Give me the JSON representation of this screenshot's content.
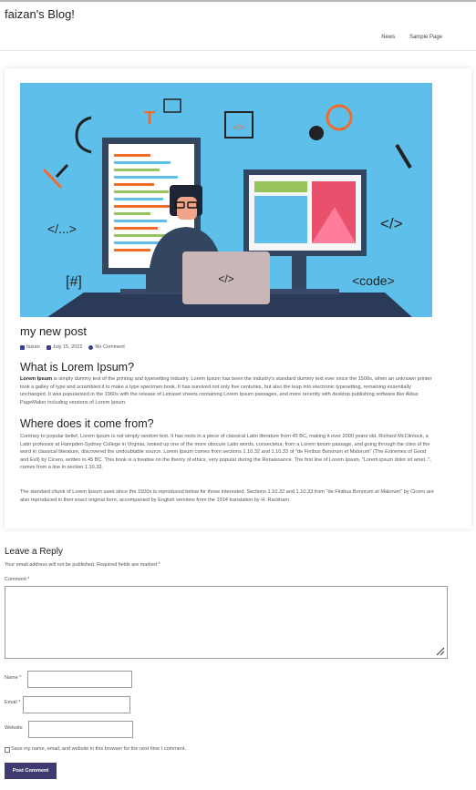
{
  "site": {
    "title": "faizan's Blog!"
  },
  "nav": {
    "items": [
      "News",
      "Sample Page"
    ]
  },
  "post": {
    "title": "my new post",
    "author": "faizan",
    "date": "July 15, 2022",
    "comments": "No Comment",
    "section1_heading": "What is Lorem Ipsum?",
    "section1_lead": "Lorem Ipsum",
    "section1_body": " is simply dummy text of the printing and typesetting industry. Lorem Ipsum has been the industry's standard dummy text ever since the 1500s, when an unknown printer took a galley of type and scrambled it to make a type specimen book. It has survived not only five centuries, but also the leap into electronic typesetting, remaining essentially unchanged. It was popularised in the 1960s with the release of Letraset sheets containing Lorem Ipsum passages, and more recently with desktop publishing software like Aldus PageMaker including versions of Lorem Ipsum.",
    "section2_heading": "Where does it come from?",
    "section2_p1": "Contrary to popular belief, Lorem Ipsum is not simply random text. It has roots in a piece of classical Latin literature from 45 BC, making it over 2000 years old. Richard McClintock, a Latin professor at Hampden-Sydney College in Virginia, looked up one of the more obscure Latin words, consectetur, from a Lorem Ipsum passage, and going through the cites of the word in classical literature, discovered the undoubtable source. Lorem Ipsum comes from sections 1.10.32 and 1.10.33 of \"de Finibus Bonorum et Malorum\" (The Extremes of Good and Evil) by Cicero, written in 45 BC. This book is a treatise on the theory of ethics, very popular during the Renaissance. The first line of Lorem Ipsum, \"Lorem ipsum dolor sit amet..\", comes from a line in section 1.10.32.",
    "section2_p2": "The standard chunk of Lorem Ipsum used since the 1500s is reproduced below for those interested. Sections 1.10.32 and 1.10.33 from \"de Finibus Bonorum et Malorum\" by Cicero are also reproduced in their exact original form, accompanied by English versions from the 1914 translation by H. Rackham."
  },
  "hero": {
    "code_tag": "</>",
    "tag_left": "</...>",
    "tag_right": "</>",
    "tag_hash": "[#]",
    "tag_code": "<code>",
    "letter_t": "T"
  },
  "reply": {
    "title": "Leave a Reply",
    "notes": "Your email address will not be published. Required fields are marked *",
    "comment_label": "Comment *",
    "name_label": "Name *",
    "email_label": "Email *",
    "website_label": "Website",
    "save_label": "Save my name, email, and website in this browser for the next time I comment.",
    "submit_label": "Post Comment"
  },
  "colors": {
    "accent": "#3f3b71",
    "hero_bg": "#5ec0ea",
    "orange": "#f26b2b"
  }
}
